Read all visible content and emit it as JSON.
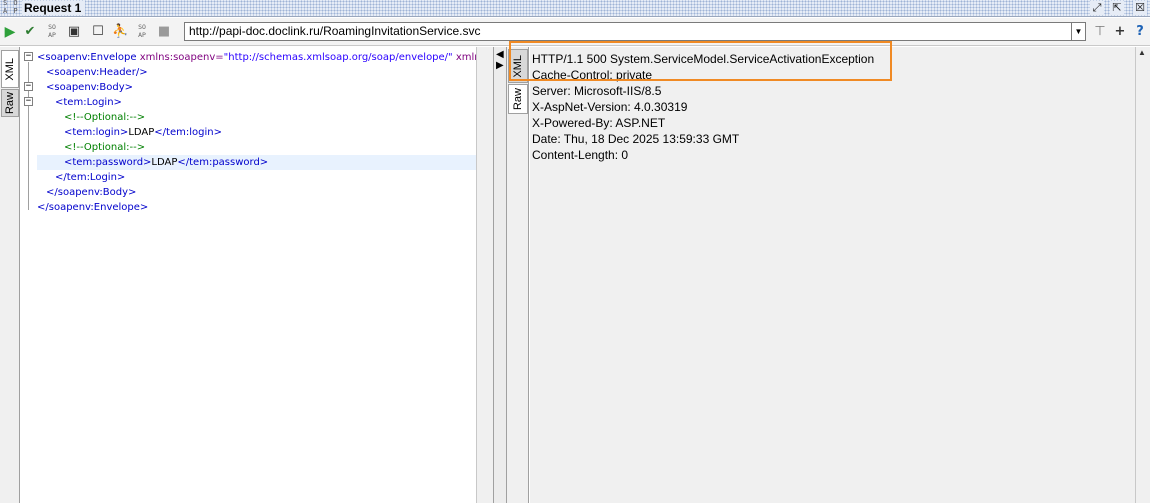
{
  "window": {
    "logo_text": "SOAP",
    "title": "Request 1"
  },
  "toolbar": {
    "url": "http://papi-doc.doclink.ru/RoamingInvitationService.svc"
  },
  "left_tabs": [
    "XML",
    "Raw"
  ],
  "right_tabs": [
    "XML",
    "Raw"
  ],
  "request_xml": [
    {
      "indent": 0,
      "parts": [
        [
          "tag",
          "<soapenv:Envelope "
        ],
        [
          "attr",
          "xmlns:soapenv="
        ],
        [
          "attrval",
          "\"http://schemas.xmlsoap.org/soap/envelope/\""
        ],
        [
          "attr",
          " xmlns:tem"
        ]
      ]
    },
    {
      "indent": 1,
      "parts": [
        [
          "tag",
          "<soapenv:Header/>"
        ]
      ]
    },
    {
      "indent": 1,
      "parts": [
        [
          "tag",
          "<soapenv:Body>"
        ]
      ]
    },
    {
      "indent": 2,
      "parts": [
        [
          "tag",
          "<tem:Login>"
        ]
      ]
    },
    {
      "indent": 3,
      "parts": [
        [
          "cmt",
          "<!--Optional:-->"
        ]
      ]
    },
    {
      "indent": 3,
      "parts": [
        [
          "tag",
          "<tem:login>"
        ],
        [
          "text",
          "LDAP"
        ],
        [
          "tag",
          "</tem:login>"
        ]
      ]
    },
    {
      "indent": 3,
      "parts": [
        [
          "cmt",
          "<!--Optional:-->"
        ]
      ]
    },
    {
      "indent": 3,
      "parts": [
        [
          "tag",
          "<tem:password>"
        ],
        [
          "text",
          "LDAP"
        ],
        [
          "tag",
          "</tem:password>"
        ]
      ]
    },
    {
      "indent": 2,
      "parts": [
        [
          "tag",
          "</tem:Login>"
        ]
      ]
    },
    {
      "indent": 1,
      "parts": [
        [
          "tag",
          "</soapenv:Body>"
        ]
      ]
    },
    {
      "indent": 0,
      "parts": [
        [
          "tag",
          "</soapenv:Envelope>"
        ]
      ]
    }
  ],
  "response_lines": [
    "HTTP/1.1 500 System.ServiceModel.ServiceActivationException",
    "Cache-Control: private",
    "Server: Microsoft-IIS/8.5",
    "X-AspNet-Version: 4.0.30319",
    "X-Powered-By: ASP.NET",
    "Date: Thu, 18 Dec 2025 13:59:33 GMT",
    "Content-Length: 0"
  ],
  "colors": {
    "highlight": "#f08a24",
    "xml_tag": "#0000cc",
    "xml_attr": "#7f007f",
    "xml_attr_value": "#2a00ff",
    "xml_comment": "#008000"
  }
}
